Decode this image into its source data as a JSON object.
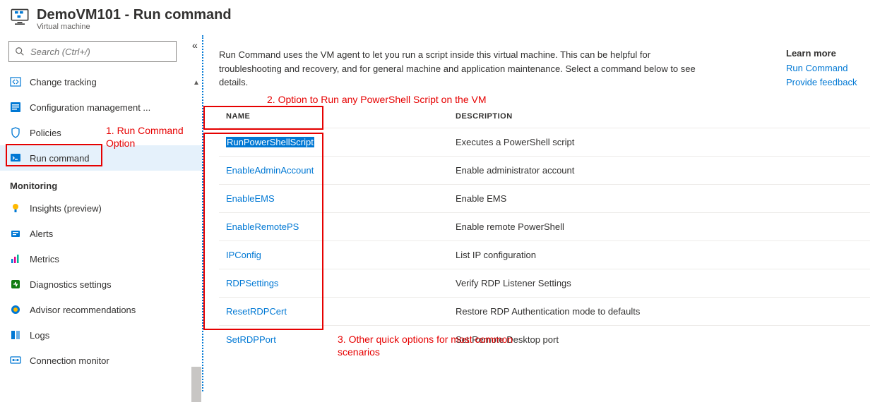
{
  "header": {
    "title": "DemoVM101 - Run command",
    "subtitle": "Virtual machine"
  },
  "search": {
    "placeholder": "Search (Ctrl+/)"
  },
  "sidebar": {
    "items": [
      {
        "label": "Change tracking"
      },
      {
        "label": "Configuration management ..."
      },
      {
        "label": "Policies"
      },
      {
        "label": "Run command"
      }
    ],
    "monitoring_header": "Monitoring",
    "monitoring": [
      {
        "label": "Insights (preview)"
      },
      {
        "label": "Alerts"
      },
      {
        "label": "Metrics"
      },
      {
        "label": "Diagnostics settings"
      },
      {
        "label": "Advisor recommendations"
      },
      {
        "label": "Logs"
      },
      {
        "label": "Connection monitor"
      }
    ]
  },
  "annotations": {
    "a1": "1. Run Command Option",
    "a2": "2. Option to Run any PowerShell Script on the VM",
    "a3": "3. Other quick options for most common scenarios"
  },
  "main": {
    "intro": "Run Command uses the VM agent to let you run a script inside this virtual machine. This can be helpful for troubleshooting and recovery, and for general machine and application maintenance. Select a command below to see details.",
    "learn_header": "Learn more",
    "learn_links": [
      "Run Command",
      "Provide feedback"
    ],
    "columns": {
      "name": "NAME",
      "desc": "DESCRIPTION"
    },
    "rows": [
      {
        "name": "RunPowerShellScript",
        "desc": "Executes a PowerShell script",
        "highlight": true
      },
      {
        "name": "EnableAdminAccount",
        "desc": "Enable administrator account"
      },
      {
        "name": "EnableEMS",
        "desc": "Enable EMS"
      },
      {
        "name": "EnableRemotePS",
        "desc": "Enable remote PowerShell"
      },
      {
        "name": "IPConfig",
        "desc": "List IP configuration"
      },
      {
        "name": "RDPSettings",
        "desc": "Verify RDP Listener Settings"
      },
      {
        "name": "ResetRDPCert",
        "desc": "Restore RDP Authentication mode to defaults"
      },
      {
        "name": "SetRDPPort",
        "desc": "Set Remote Desktop port"
      }
    ]
  }
}
